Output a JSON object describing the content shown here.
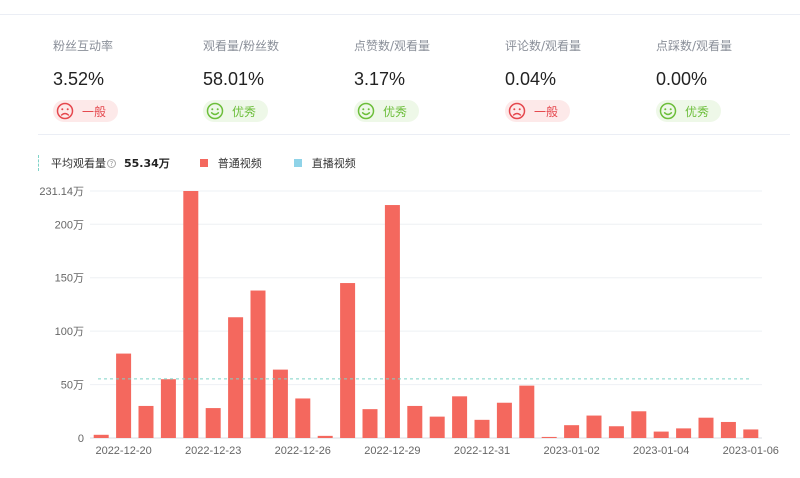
{
  "metrics": [
    {
      "label": "粉丝互动率",
      "value": "3.52%",
      "rating": "一般",
      "status": "bad"
    },
    {
      "label": "观看量/粉丝数",
      "value": "58.01%",
      "rating": "优秀",
      "status": "good"
    },
    {
      "label": "点赞数/观看量",
      "value": "3.17%",
      "rating": "优秀",
      "status": "good"
    },
    {
      "label": "评论数/观看量",
      "value": "0.04%",
      "rating": "一般",
      "status": "bad"
    },
    {
      "label": "点踩数/观看量",
      "value": "0.00%",
      "rating": "优秀",
      "status": "good"
    }
  ],
  "colors": {
    "bad": "#e5474d",
    "good": "#6cbe3a",
    "bar": "#f4685e",
    "live": "#8fd3e8",
    "avg_line": "#7fd3c8"
  },
  "legend": {
    "avg_label": "平均观看量",
    "avg_value": "55.34万",
    "series_normal": "普通视频",
    "series_live": "直播视频"
  },
  "chart_data": {
    "type": "bar",
    "series": [
      {
        "name": "普通视频",
        "values": [
          3,
          79,
          30,
          55,
          231.14,
          28,
          113,
          138,
          64,
          37,
          2,
          145,
          27,
          218,
          30,
          20,
          39,
          17,
          33,
          49,
          1,
          12,
          21,
          11,
          25,
          6,
          9,
          19,
          15,
          8
        ]
      },
      {
        "name": "直播视频",
        "values": []
      }
    ],
    "x_tick_labels": [
      {
        "index": 1,
        "label": "2022-12-20"
      },
      {
        "index": 5,
        "label": "2022-12-23"
      },
      {
        "index": 9,
        "label": "2022-12-26"
      },
      {
        "index": 13,
        "label": "2022-12-29"
      },
      {
        "index": 17,
        "label": "2022-12-31"
      },
      {
        "index": 21,
        "label": "2023-01-02"
      },
      {
        "index": 25,
        "label": "2023-01-04"
      },
      {
        "index": 29,
        "label": "2023-01-06"
      }
    ],
    "y_ticks": [
      {
        "value": 0,
        "label": "0"
      },
      {
        "value": 50,
        "label": "50万"
      },
      {
        "value": 100,
        "label": "100万"
      },
      {
        "value": 150,
        "label": "150万"
      },
      {
        "value": 200,
        "label": "200万"
      },
      {
        "value": 231.14,
        "label": "231.14万"
      }
    ],
    "ylim": [
      0,
      231.14
    ],
    "average": 55.34,
    "unit": "万",
    "grid": true
  }
}
